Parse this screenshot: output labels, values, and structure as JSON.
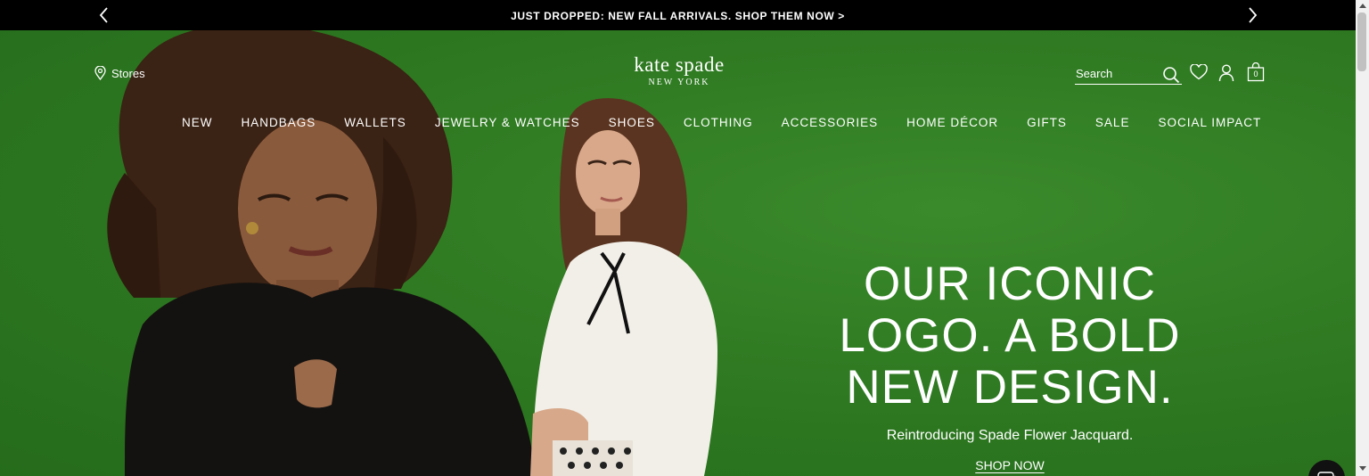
{
  "promo": {
    "text": "JUST DROPPED: NEW FALL ARRIVALS. SHOP THEM NOW >",
    "prev_icon": "chevron-left-icon",
    "next_icon": "chevron-right-icon"
  },
  "header": {
    "stores_label": "Stores",
    "stores_icon": "map-pin-icon",
    "logo_main": "kate spade",
    "logo_sub": "NEW YORK",
    "search_placeholder": "Search",
    "bag_count": "0"
  },
  "nav": {
    "items": [
      "NEW",
      "HANDBAGS",
      "WALLETS",
      "JEWELRY & WATCHES",
      "SHOES",
      "CLOTHING",
      "ACCESSORIES",
      "HOME DÉCOR",
      "GIFTS",
      "SALE",
      "SOCIAL IMPACT"
    ]
  },
  "hero": {
    "headline_lines": [
      "OUR ICONIC",
      "LOGO. A BOLD",
      "NEW DESIGN."
    ],
    "subhead": "Reintroducing Spade Flower Jacquard.",
    "cta": "SHOP NOW"
  },
  "colors": {
    "promo_bg": "#000000",
    "hero_green": "#2f7a22",
    "text": "#ffffff"
  }
}
